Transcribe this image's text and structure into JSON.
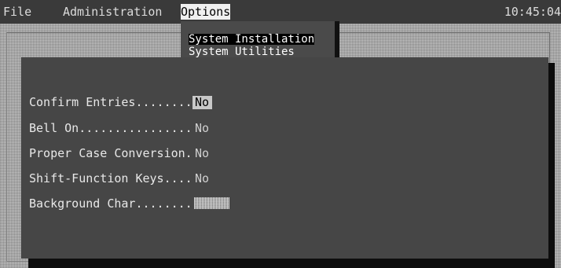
{
  "menubar": {
    "items": [
      {
        "label": "File"
      },
      {
        "label": "Administration"
      },
      {
        "label": "Options",
        "selected": true
      }
    ],
    "clock": "10:45:04"
  },
  "options_menu": {
    "items": [
      {
        "label": "System Installation",
        "highlighted": true
      },
      {
        "label": "System Utilities"
      }
    ]
  },
  "settings": {
    "rows": [
      {
        "label": "Confirm Entries........",
        "value": "No",
        "active": true
      },
      {
        "label": "Bell On................",
        "value": "No"
      },
      {
        "label": "Proper Case Conversion.",
        "value": "No"
      },
      {
        "label": "Shift-Function Keys....",
        "value": "No"
      },
      {
        "label": "Background Char........",
        "value": ""
      }
    ]
  },
  "colors": {
    "menubar_bg": "#3a3a3a",
    "panel_bg": "#464646",
    "highlight_bg": "#000000",
    "selected_menu_bg": "#f0f0f0"
  }
}
